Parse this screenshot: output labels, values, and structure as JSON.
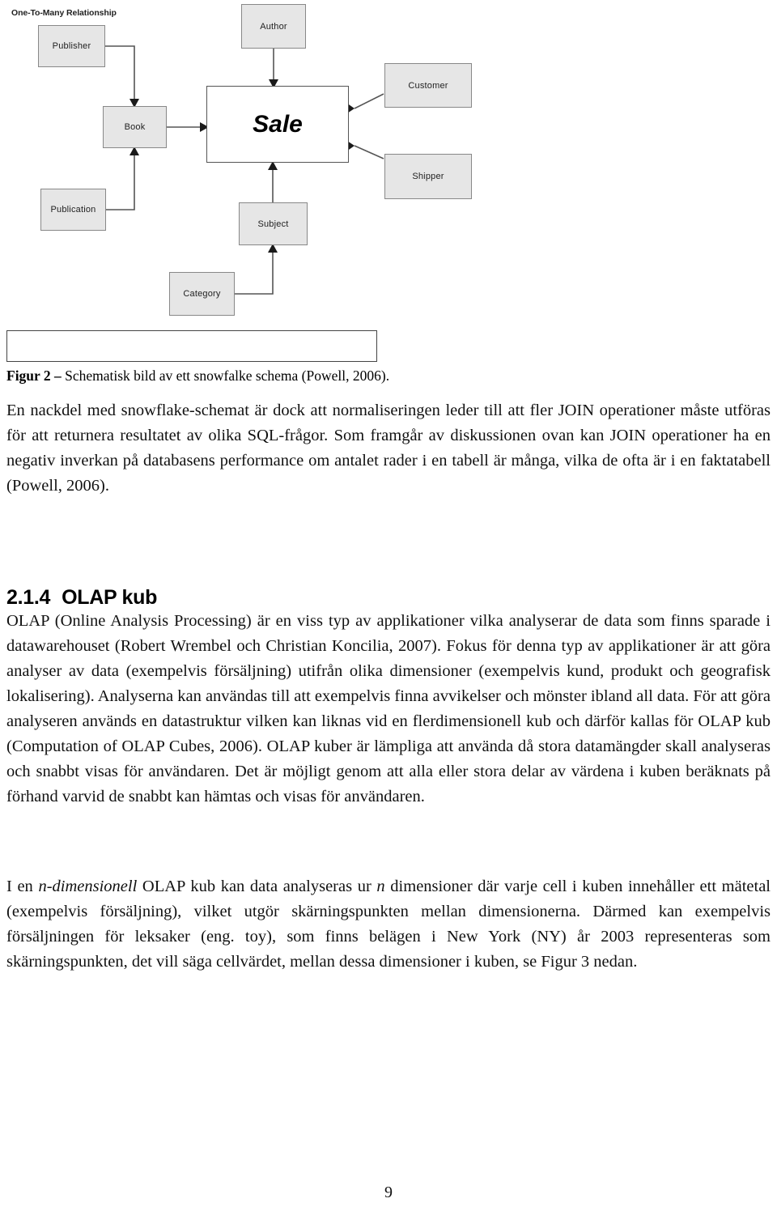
{
  "page": {
    "number": "9"
  },
  "figure": {
    "entities": [
      {
        "id": "publisher",
        "label": "Publisher"
      },
      {
        "id": "author",
        "label": "Author"
      },
      {
        "id": "customer",
        "label": "Customer"
      },
      {
        "id": "book",
        "label": "Book"
      },
      {
        "id": "shipper",
        "label": "Shipper"
      },
      {
        "id": "publication",
        "label": "Publication"
      },
      {
        "id": "subject",
        "label": "Subject"
      },
      {
        "id": "category",
        "label": "Category"
      }
    ],
    "fact_table": {
      "id": "sale",
      "label": "Sale"
    },
    "legend": {
      "label": "One-To-Many Relationship"
    },
    "relationships": [
      {
        "from": "Publisher",
        "to": "Book"
      },
      {
        "from": "Publication",
        "to": "Book"
      },
      {
        "from": "Book",
        "to": "Sale"
      },
      {
        "from": "Author",
        "to": "Sale"
      },
      {
        "from": "Customer",
        "to": "Sale"
      },
      {
        "from": "Shipper",
        "to": "Sale"
      },
      {
        "from": "Subject",
        "to": "Sale"
      },
      {
        "from": "Category",
        "to": "Subject"
      }
    ],
    "colors": {
      "entity_fill": "#e6e6e6",
      "entity_stroke": "#888888",
      "fact_fill": "#ffffff",
      "fact_stroke": "#555555",
      "connector": "#555555",
      "legend_stroke": "#444444"
    }
  },
  "caption": {
    "label": "Figur 2",
    "dash": " – ",
    "text": "Schematisk bild av ett snowfalke schema (Powell, 2006)."
  },
  "heading": {
    "number": "2.1.4",
    "title": "OLAP kub"
  },
  "paragraphs": {
    "p1": "En nackdel med snowflake-schemat är dock att normaliseringen leder till att fler JOIN operationer måste utföras för att returnera resultatet av olika SQL-frågor. Som framgår av diskussionen ovan kan JOIN operationer ha en negativ inverkan på databasens performance om antalet rader i en tabell är många, vilka de ofta är i en faktatabell (Powell, 2006).",
    "p2": "OLAP (Online Analysis Processing) är en viss typ av applikationer vilka analyserar de data som finns sparade i datawarehouset (Robert Wrembel och Christian Koncilia, 2007). Fokus för denna typ av applikationer är att göra analyser av data (exempelvis försäljning) utifrån olika dimensioner (exempelvis kund, produkt och geografisk lokalisering). Analyserna kan användas till att exempelvis finna avvikelser och mönster ibland all data. För att göra analyseren används en datastruktur vilken kan liknas vid en flerdimensionell kub och därför kallas för OLAP kub (Computation of OLAP Cubes, 2006). OLAP kuber är lämpliga att använda då stora datamängder skall analyseras och snabbt visas för användaren. Det är möjligt genom att alla eller stora delar av värdena i kuben beräknats på förhand varvid de snabbt kan hämtas och visas för användaren.",
    "p3_a": "I en ",
    "p3_italic_1": "n-dimensionell",
    "p3_b": " OLAP kub kan data analyseras ur ",
    "p3_italic_2": "n",
    "p3_c": " dimensioner där varje cell i kuben innehåller ett mätetal (exempelvis försäljning), vilket utgör skärningspunkten mellan dimensionerna. Därmed kan exempelvis försäljningen för leksaker (eng. toy), som finns belägen i New York (NY) år 2003 representeras som skärningspunkten, det vill säga cellvärdet, mellan dessa dimensioner i kuben, se Figur 3 nedan."
  }
}
